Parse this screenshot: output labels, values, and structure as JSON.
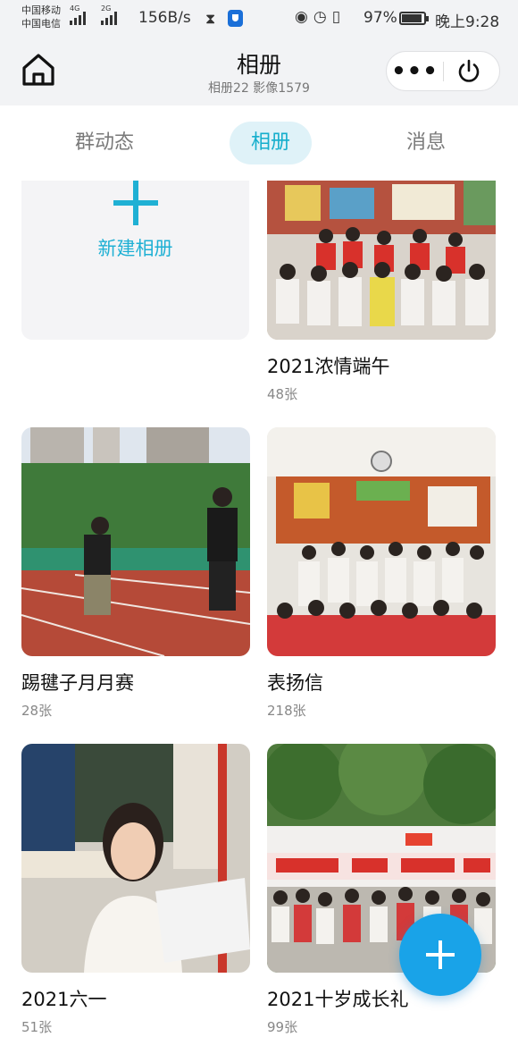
{
  "status_bar": {
    "carrier_1": "中国移动",
    "carrier_2": "中国电信",
    "sig1_tag": "4G",
    "sig2_tag": "2G",
    "net_speed": "156B/s",
    "battery_percent": "97%",
    "time": "晚上9:28",
    "icons": [
      "hourglass-icon",
      "shield-app-icon",
      "eye-icon",
      "alarm-icon",
      "vibrate-icon",
      "battery-icon"
    ]
  },
  "header": {
    "title": "相册",
    "subtitle": "相册22 影像1579",
    "more_label": "•••"
  },
  "tabs": [
    {
      "label": "群动态",
      "active": false
    },
    {
      "label": "相册",
      "active": true
    },
    {
      "label": "消息",
      "active": false
    }
  ],
  "new_album": {
    "label": "新建相册"
  },
  "albums": [
    {
      "name": "2021浓情端午",
      "count": "48张"
    },
    {
      "name": "踢毽子月月赛",
      "count": "28张"
    },
    {
      "name": "表扬信",
      "count": "218张"
    },
    {
      "name": "2021六一",
      "count": "51张"
    },
    {
      "name": "2021十岁成长礼",
      "count": "99张"
    }
  ],
  "colors": {
    "accent": "#1fb0d4",
    "tab_active_bg": "#dff2f8",
    "fab": "#19a3e8",
    "header_bg": "#f2f3f5"
  }
}
